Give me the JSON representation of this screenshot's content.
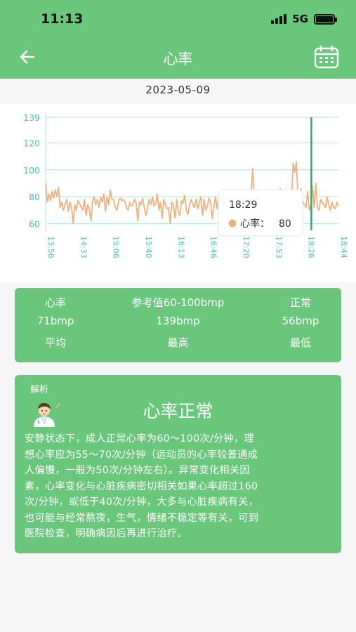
{
  "status_bar": {
    "time": "11:13",
    "network": "5G"
  },
  "header": {
    "title": "心率"
  },
  "date": "2023-05-09",
  "chart_data": {
    "type": "line",
    "y_ticks": [
      "139",
      "120",
      "100",
      "80",
      "60"
    ],
    "ylim": [
      55,
      139
    ],
    "x_ticks": [
      "13:56",
      "14:33",
      "15:06",
      "15:40",
      "16:13",
      "16:46",
      "17:20",
      "17:53",
      "18:26",
      "18:44"
    ],
    "series": [
      {
        "color": "#efb27e",
        "values": [
          90,
          76,
          82,
          77,
          84,
          79,
          85,
          80,
          87,
          72,
          76,
          70,
          74,
          78,
          69,
          76,
          72,
          60,
          74,
          70,
          77,
          75,
          72,
          70,
          78,
          66,
          74,
          71,
          62,
          76,
          80,
          74,
          78,
          72,
          80,
          76,
          82,
          69,
          80,
          74,
          85,
          78,
          78,
          72,
          70,
          76,
          79,
          77,
          78,
          76,
          72,
          70,
          76,
          73,
          74,
          78,
          75,
          62,
          76,
          74,
          79,
          72,
          66,
          71,
          78,
          74,
          80,
          73,
          75,
          82,
          70,
          76,
          64,
          78,
          74,
          71,
          72,
          60,
          76,
          74,
          64,
          78,
          69,
          66,
          77,
          75,
          81,
          70,
          67,
          74,
          78,
          74,
          72,
          78,
          71,
          76,
          80,
          66,
          78,
          70,
          73,
          79,
          76,
          64,
          72,
          80,
          71,
          80,
          69,
          77,
          76,
          83,
          70,
          73,
          82,
          56,
          74,
          79,
          70,
          84,
          72,
          61,
          76,
          80,
          68,
          72,
          77,
          82,
          101,
          78,
          74,
          80,
          70,
          76,
          72,
          78,
          74,
          76,
          73,
          80,
          74,
          75,
          80,
          72,
          78,
          86,
          74,
          72,
          80,
          84,
          70,
          74,
          78,
          105,
          98,
          106,
          80,
          70,
          86,
          76,
          74,
          72,
          84,
          70,
          74,
          88,
          72,
          90,
          72,
          70,
          78,
          76,
          74,
          72,
          80,
          74,
          70,
          76,
          72,
          71,
          76,
          73
        ]
      }
    ],
    "cursor": {
      "time": "18:29",
      "series_label": "心率：",
      "value": "80"
    }
  },
  "stats": {
    "row1": [
      "心率",
      "参考值60-100bmp",
      "正常"
    ],
    "row2": [
      "71bmp",
      "139bmp",
      "56bmp"
    ],
    "row3": [
      "平均",
      "最高",
      "最低"
    ]
  },
  "analysis": {
    "label": "解析",
    "verdict": "心率正常",
    "lines": [
      "安静状态下，成人正常心率为60～100次/分钟，理",
      "想心率应为55～70次/分钟（运动员的心率较普通成",
      "人偏慢，一般为50次/分钟左右）。异常变化相关因",
      "素，心率变化与心脏疾病密切相关如果心率超过160",
      "次/分钟，或低于40次/分钟，大多与心脏疾病有关，",
      "也可能与经常熬夜，生气，情绪不稳定等有关，可到",
      "医院检查，明确病因后再进行治疗。"
    ]
  },
  "icons": {
    "back": "back-arrow-icon",
    "calendar": "calendar-icon",
    "doctor": "doctor-icon"
  },
  "colors": {
    "accent": "#69c77b",
    "line": "#efb27e",
    "grid": "#b8ece0",
    "marker": "#3ba87a"
  }
}
